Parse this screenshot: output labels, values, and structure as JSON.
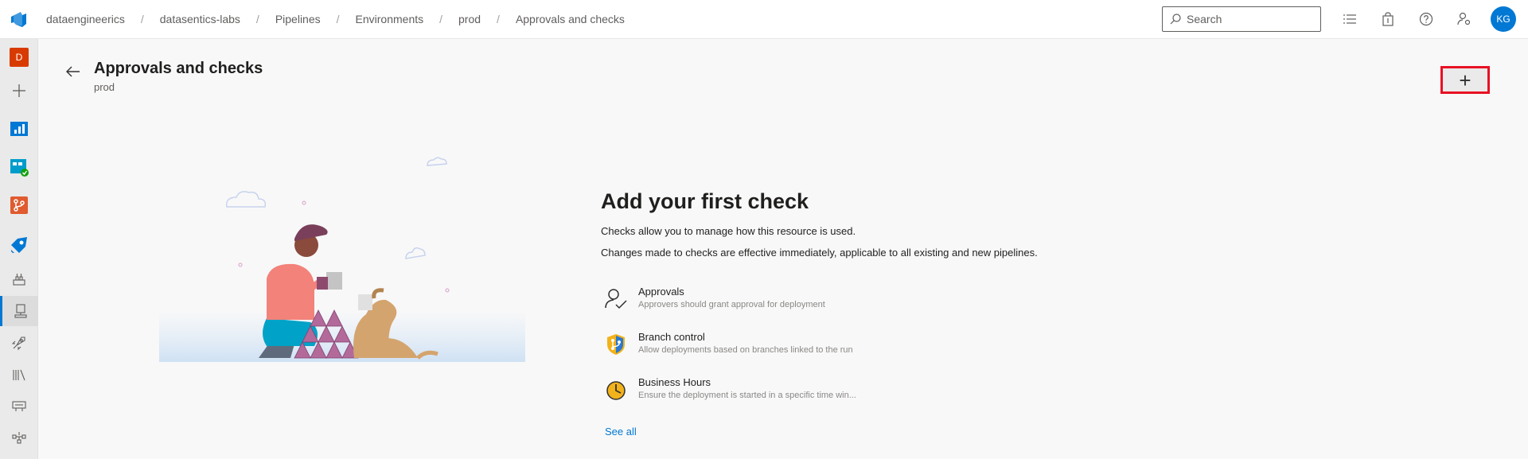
{
  "breadcrumbs": [
    "dataengineerics",
    "datasentics-labs",
    "Pipelines",
    "Environments",
    "prod",
    "Approvals and checks"
  ],
  "search": {
    "placeholder": "Search"
  },
  "user": {
    "initials": "KG"
  },
  "project": {
    "initial": "D"
  },
  "header": {
    "title": "Approvals and checks",
    "subtitle": "prod"
  },
  "empty_state": {
    "title": "Add your first check",
    "line1": "Checks allow you to manage how this resource is used.",
    "line2": "Changes made to checks are effective immediately, applicable to all existing and new pipelines."
  },
  "checks": [
    {
      "name": "Approvals",
      "description": "Approvers should grant approval for deployment",
      "icon": "approvals-icon"
    },
    {
      "name": "Branch control",
      "description": "Allow deployments based on branches linked to the run",
      "icon": "branch-control-icon"
    },
    {
      "name": "Business Hours",
      "description": "Ensure the deployment is started in a specific time win...",
      "icon": "business-hours-icon"
    }
  ],
  "see_all": "See all",
  "colors": {
    "accent": "#0078d4",
    "highlight": "#e81123",
    "project_badge": "#d83b01"
  }
}
